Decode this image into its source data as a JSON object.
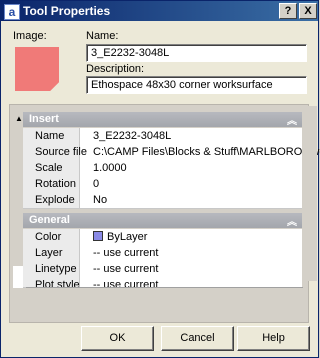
{
  "window": {
    "title": "Tool Properties",
    "help_btn": "?",
    "close_btn": "X",
    "app_icon": "a"
  },
  "form": {
    "image_label": "Image:",
    "name_label": "Name:",
    "name_value": "3_E2232-3048L",
    "description_label": "Description:",
    "description_value": "Ethospace 48x30 corner worksurface"
  },
  "sections": {
    "insert": {
      "title": "Insert",
      "rows": [
        {
          "key": "Name",
          "value": "3_E2232-3048L"
        },
        {
          "key": "Source file",
          "value": "C:\\CAMP Files\\Blocks & Stuff\\MARLBORO.dwg"
        },
        {
          "key": "Scale",
          "value": "1.0000"
        },
        {
          "key": "Rotation",
          "value": "0"
        },
        {
          "key": "Explode",
          "value": "No"
        }
      ]
    },
    "general": {
      "title": "General",
      "rows": [
        {
          "key": "Color",
          "value": "ByLayer"
        },
        {
          "key": "Layer",
          "value": "-- use current"
        },
        {
          "key": "Linetype",
          "value": "-- use current"
        },
        {
          "key": "Plot style",
          "value": "-- use current"
        }
      ]
    }
  },
  "buttons": {
    "ok": "OK",
    "cancel": "Cancel",
    "help": "Help"
  },
  "icons": {
    "collapse": "chevron-up-icon"
  },
  "colors": {
    "image_swatch": "#f07a78",
    "layer_color": "#8a8ae6"
  }
}
